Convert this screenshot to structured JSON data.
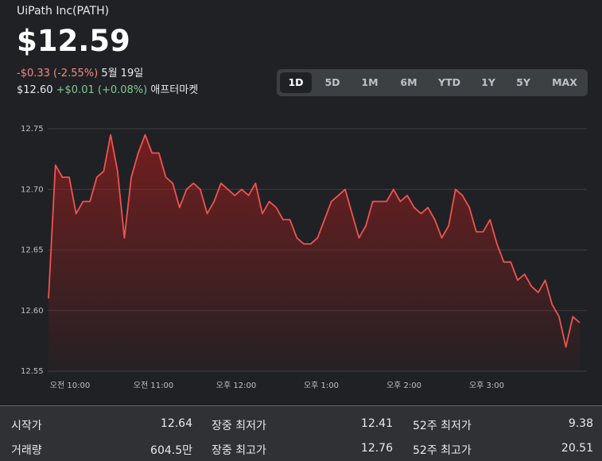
{
  "header": {
    "title": "UiPath Inc(PATH)",
    "price": "$12.59",
    "change": "-$0.33 (-2.55%)",
    "date": "5월 19일",
    "after_price": "$12.60",
    "after_change": "+$0.01 (+0.08%)",
    "after_label": "애프터마켓"
  },
  "ranges": [
    "1D",
    "5D",
    "1M",
    "6M",
    "YTD",
    "1Y",
    "5Y",
    "MAX"
  ],
  "selected_range": "1D",
  "colors": {
    "line": "#ef5350",
    "positive": "#81c995",
    "negative": "#f28b82",
    "background": "#202124"
  },
  "chart_data": {
    "type": "area",
    "ylim": [
      12.55,
      12.75
    ],
    "yticks": [
      "12.75",
      "12.70",
      "12.65",
      "12.60",
      "12.55"
    ],
    "xticks": [
      "오전 10:00",
      "오전 11:00",
      "오후 12:00",
      "오후 1:00",
      "오후 2:00",
      "오후 3:00"
    ],
    "grid": true,
    "values": [
      12.61,
      12.72,
      12.71,
      12.71,
      12.68,
      12.69,
      12.69,
      12.71,
      12.715,
      12.745,
      12.715,
      12.66,
      12.71,
      12.73,
      12.745,
      12.73,
      12.73,
      12.71,
      12.705,
      12.685,
      12.7,
      12.705,
      12.7,
      12.68,
      12.69,
      12.705,
      12.7,
      12.695,
      12.7,
      12.695,
      12.705,
      12.68,
      12.69,
      12.685,
      12.675,
      12.675,
      12.66,
      12.655,
      12.655,
      12.66,
      12.675,
      12.69,
      12.695,
      12.7,
      12.68,
      12.66,
      12.67,
      12.69,
      12.69,
      12.69,
      12.7,
      12.69,
      12.695,
      12.685,
      12.68,
      12.685,
      12.675,
      12.66,
      12.67,
      12.7,
      12.695,
      12.685,
      12.665,
      12.665,
      12.675,
      12.655,
      12.64,
      12.64,
      12.625,
      12.63,
      12.62,
      12.615,
      12.625,
      12.605,
      12.595,
      12.57,
      12.595,
      12.59
    ]
  },
  "stats": [
    {
      "label": "시작가",
      "value": "12.64"
    },
    {
      "label": "장중 최저가",
      "value": "12.41"
    },
    {
      "label": "52주 최저가",
      "value": "9.38"
    },
    {
      "label": "거래량",
      "value": "604.5만"
    },
    {
      "label": "장중 최고가",
      "value": "12.76"
    },
    {
      "label": "52주 최고가",
      "value": "20.51"
    }
  ]
}
